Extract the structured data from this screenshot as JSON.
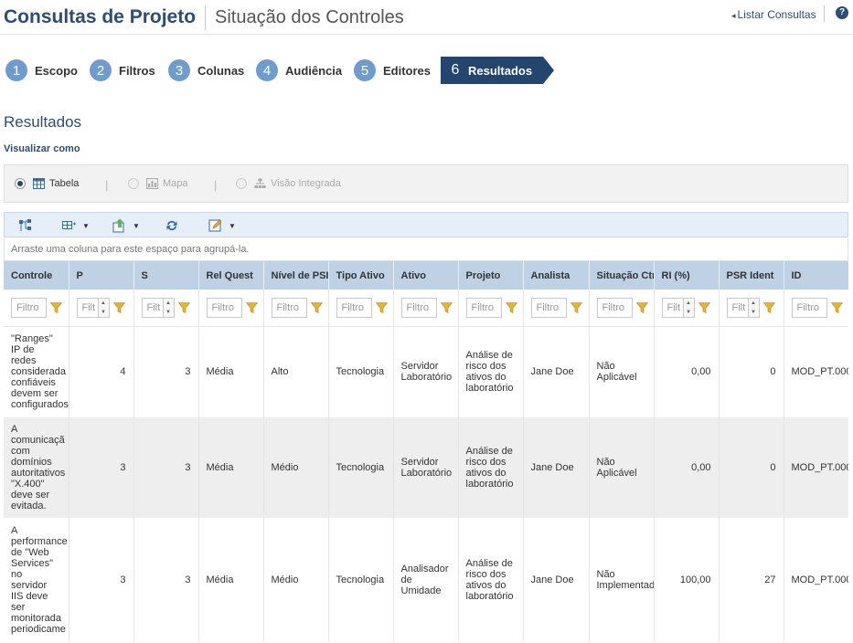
{
  "header": {
    "title": "Consultas de Projeto",
    "subtitle": "Situação dos Controles",
    "list_link": "Listar Consultas",
    "help_icon": "?"
  },
  "steps": [
    {
      "num": "1",
      "label": "Escopo"
    },
    {
      "num": "2",
      "label": "Filtros"
    },
    {
      "num": "3",
      "label": "Colunas"
    },
    {
      "num": "4",
      "label": "Audiência"
    },
    {
      "num": "5",
      "label": "Editores"
    },
    {
      "num": "6",
      "label": "Resultados"
    }
  ],
  "section_title": "Resultados",
  "view_as_label": "Visualizar como",
  "view_options": {
    "table": "Tabela",
    "map": "Mapa",
    "integrated": "Visão Integrada",
    "separator": "|"
  },
  "group_hint": "Arraste uma coluna para este espaço para agrupá-la.",
  "columns": [
    "Controle",
    "P",
    "S",
    "Rel Quest",
    "Nível de PSI",
    "Tipo Ativo",
    "Ativo",
    "Projeto",
    "Analista",
    "Situação Ctrl",
    "RI (%)",
    "PSR Ident",
    "ID"
  ],
  "filter_placeholders": [
    "Filtro",
    "Filt",
    "Filt",
    "Filtro",
    "Filtro",
    "Filtro",
    "Filtro",
    "Filtro",
    "Filtro",
    "Filtro",
    "Filt",
    "Filt",
    "Filtro"
  ],
  "rows": [
    {
      "controle": "\"Ranges\"\nIP de\nredes\nconsiderada\nconfiáveis\ndevem ser\nconfigurados",
      "p": "4",
      "s": "3",
      "rel_quest": "Média",
      "nivel_psi": "Alto",
      "tipo_ativo": "Tecnologia",
      "ativo": "Servidor Laboratório",
      "projeto": "Análise de risco dos ativos do laboratório",
      "analista": "Jane Doe",
      "situacao": "Não Aplicável",
      "ri": "0,00",
      "psr": "0",
      "id": "MOD_PT.000"
    },
    {
      "controle": "A\ncomunicaçã\ncom\ndomínios\nautoritativos\n\"X.400\"\ndeve ser\nevitada.",
      "p": "3",
      "s": "3",
      "rel_quest": "Média",
      "nivel_psi": "Médio",
      "tipo_ativo": "Tecnologia",
      "ativo": "Servidor Laboratório",
      "projeto": "Análise de risco dos ativos do laboratório",
      "analista": "Jane Doe",
      "situacao": "Não Aplicável",
      "ri": "0,00",
      "psr": "0",
      "id": "MOD_PT.000"
    },
    {
      "controle": "A\nperformance\nde \"Web\nServices\"\nno\nservidor\nIIS deve\nser\nmonitorada\nperiodicame",
      "p": "3",
      "s": "3",
      "rel_quest": "Média",
      "nivel_psi": "Médio",
      "tipo_ativo": "Tecnologia",
      "ativo": "Analisador de Umidade",
      "projeto": "Análise de risco dos ativos do laboratório",
      "analista": "Jane Doe",
      "situacao": "Não Implementado",
      "ri": "100,00",
      "psr": "27",
      "id": "MOD_PT.000"
    }
  ]
}
